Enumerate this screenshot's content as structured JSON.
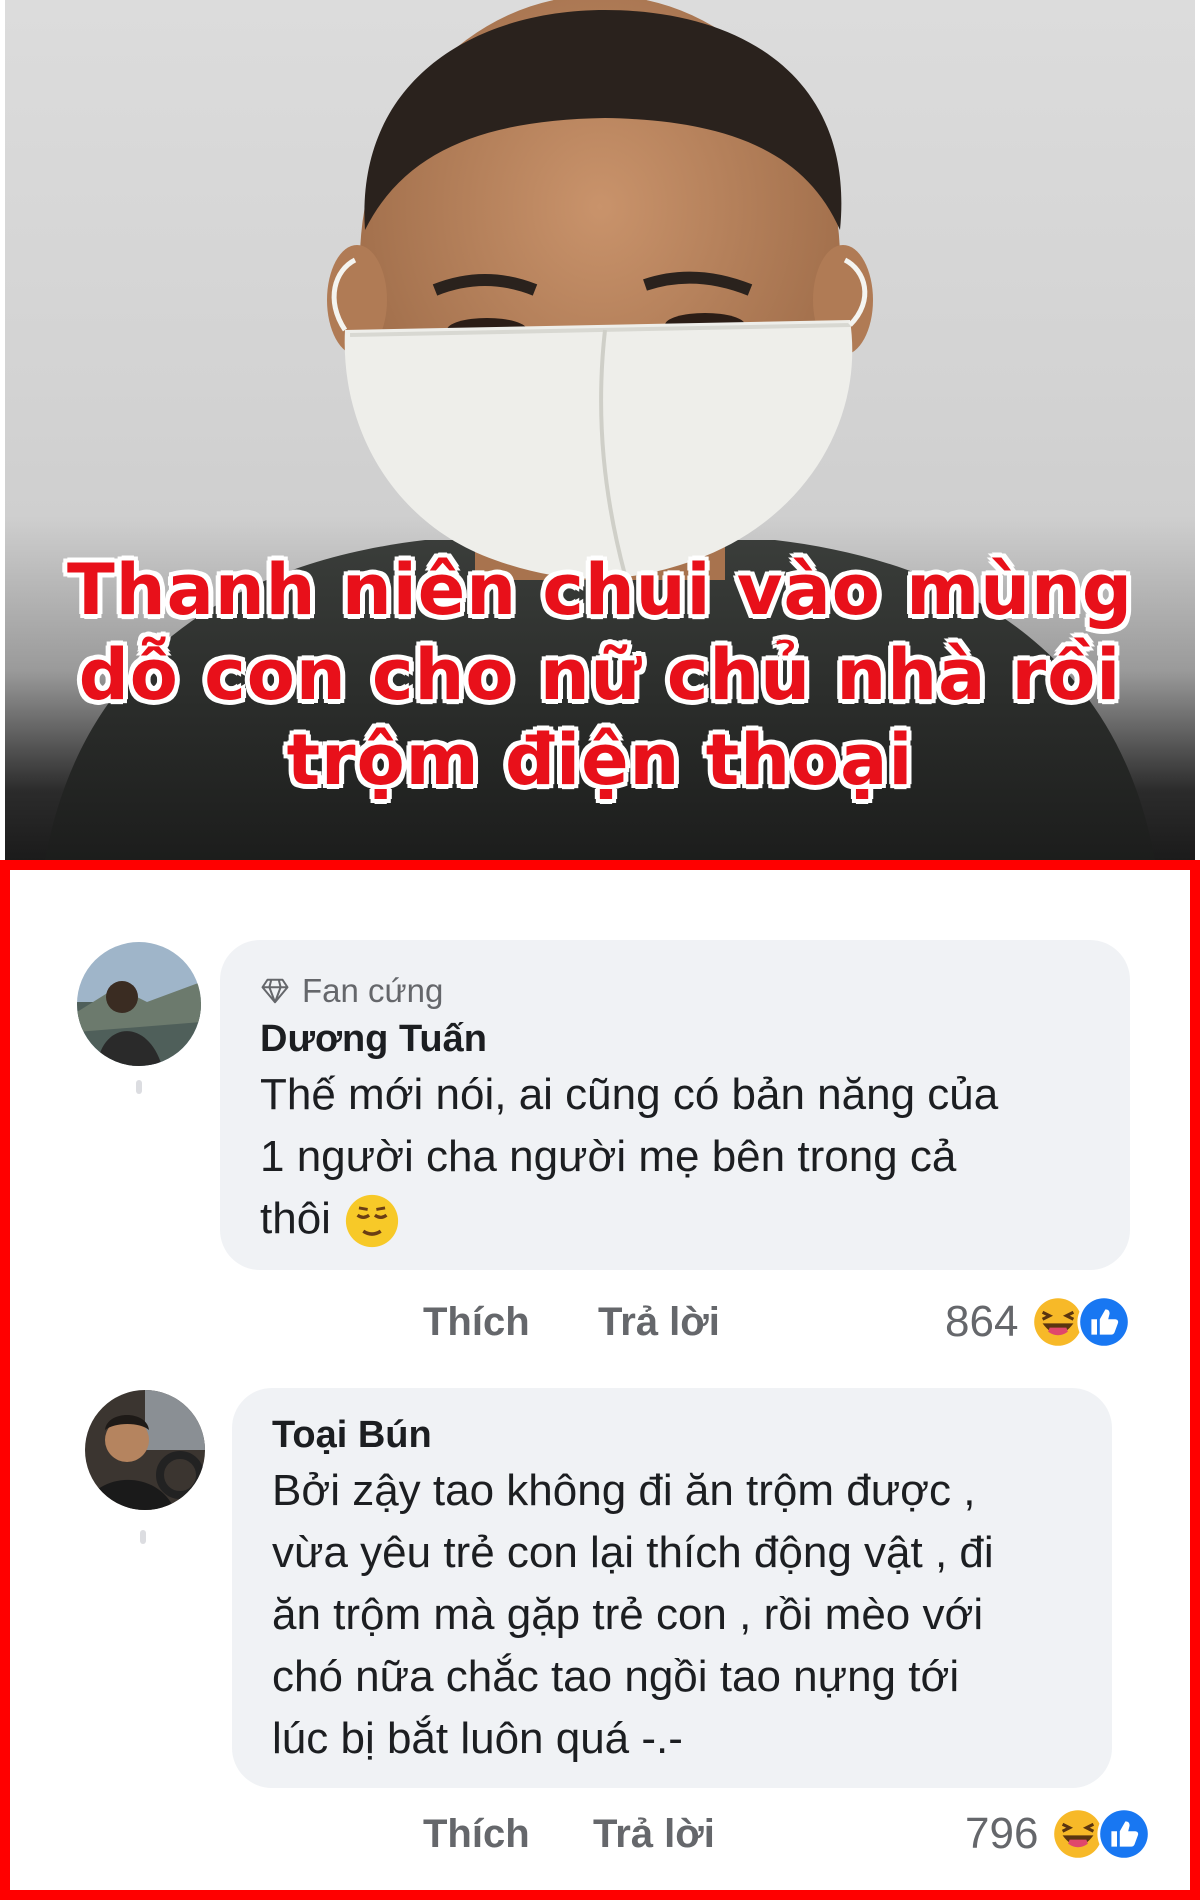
{
  "headline": {
    "line1": "Thanh niên chui vào mùng",
    "line2": "dỗ con cho nữ chủ nhà rồi",
    "line3": "trộm điện thoại"
  },
  "comments": [
    {
      "badge": "Fan cứng",
      "author": "Dương Tuấn",
      "lines": [
        "Thế mới nói, ai cũng có bản năng của",
        "1 người cha người mẹ bên trong cả",
        "thôi"
      ],
      "emoji": "relieved-face",
      "like_label": "Thích",
      "reply_label": "Trả lời",
      "reaction_count": "864",
      "reactions": [
        "haha",
        "like"
      ]
    },
    {
      "author": "Toại Bún",
      "lines": [
        "Bởi zậy tao không đi ăn trộm được ,",
        "vừa yêu trẻ con lại thích động vật , đi",
        "ăn trộm mà gặp trẻ con , rồi mèo với",
        "chó nữa chắc tao ngồi tao nựng tới",
        "lúc bị bắt luôn quá -.-"
      ],
      "like_label": "Thích",
      "reply_label": "Trả lời",
      "reaction_count": "796",
      "reactions": [
        "haha",
        "like"
      ]
    }
  ],
  "colors": {
    "headline": "#e8101a",
    "frame": "#ff0000",
    "bubble": "#f0f2f5",
    "like_blue": "#1877f2",
    "haha_yellow": "#f7b928"
  }
}
